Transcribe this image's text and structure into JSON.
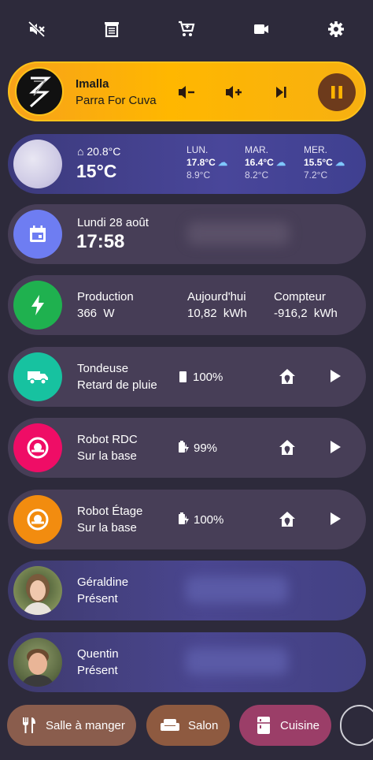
{
  "topbar": {
    "icons": [
      "volume-off-icon",
      "receipt-icon",
      "cart-icon",
      "video-camera-icon",
      "gear-icon"
    ]
  },
  "media": {
    "artist": "Imalla",
    "track": "Parra For Cuva",
    "accent": "#ffb300"
  },
  "weather": {
    "indoor": "20.8°C",
    "outdoor": "15°C",
    "forecast": [
      {
        "day": "LUN.",
        "high": "17.8°C",
        "low": "8.9°C"
      },
      {
        "day": "MAR.",
        "high": "16.4°C",
        "low": "8.2°C"
      },
      {
        "day": "MER.",
        "high": "15.5°C",
        "low": "7.2°C"
      }
    ]
  },
  "datetime": {
    "date": "Lundi 28 août",
    "time": "17:58"
  },
  "energy": {
    "production_label": "Production",
    "production_value": "366  W",
    "today_label": "Aujourd'hui",
    "today_value": "10,82  kWh",
    "meter_label": "Compteur",
    "meter_value": "-916,2  kWh"
  },
  "devices": [
    {
      "name": "Tondeuse",
      "status": "Retard de pluie",
      "battery": "100%"
    },
    {
      "name": "Robot RDC",
      "status": "Sur la base",
      "battery": "99%"
    },
    {
      "name": "Robot Étage",
      "status": "Sur la base",
      "battery": "100%"
    }
  ],
  "persons": [
    {
      "name": "Géraldine",
      "status": "Présent"
    },
    {
      "name": "Quentin",
      "status": "Présent"
    }
  ],
  "rooms": [
    {
      "label": "Salle à manger"
    },
    {
      "label": "Salon"
    },
    {
      "label": "Cuisine"
    }
  ]
}
